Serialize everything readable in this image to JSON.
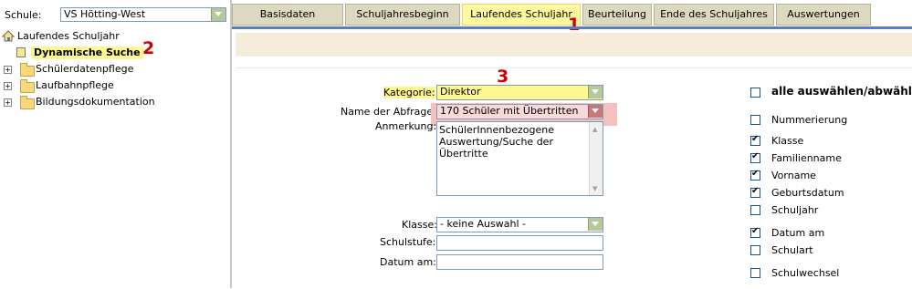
{
  "sidebar": {
    "school_label": "Schule:",
    "school_value": "VS Hötting-West",
    "tree": [
      {
        "label": "Laufendes Schuljahr"
      },
      {
        "label": "Dynamische Suche"
      },
      {
        "label": "Schülerdatenpflege"
      },
      {
        "label": "Laufbahnpflege"
      },
      {
        "label": "Bildungsdokumentation"
      }
    ]
  },
  "tabs": [
    {
      "label": "Basisdaten"
    },
    {
      "label": "Schuljahresbeginn"
    },
    {
      "label": "Laufendes Schuljahr"
    },
    {
      "label": "Beurteilung"
    },
    {
      "label": "Ende des Schuljahres"
    },
    {
      "label": "Auswertungen"
    }
  ],
  "markers": {
    "one": "1",
    "two": "2",
    "three": "3"
  },
  "form": {
    "kategorie_label": "Kategorie:",
    "kategorie_value": "Direktor",
    "abfrage_label": "Name der Abfrage:",
    "abfrage_value": "170 Schüler mit Übertritten",
    "anmerkung_label": "Anmerkung:",
    "anmerkung_value": "SchülerInnenbezogene Auswertung/Suche der Übertritte",
    "klasse_label": "Klasse:",
    "klasse_value": "- keine Auswahl -",
    "schulstufe_label": "Schulstufe:",
    "schulstufe_value": "",
    "datum_label": "Datum am:",
    "datum_value": ""
  },
  "columns": {
    "select_all": "alle auswählen/abwählen",
    "items": [
      {
        "label": "Nummerierung",
        "checked": false
      },
      {
        "label": "Klasse",
        "checked": true
      },
      {
        "label": "Familienname",
        "checked": true
      },
      {
        "label": "Vorname",
        "checked": true
      },
      {
        "label": "Geburtsdatum",
        "checked": true
      },
      {
        "label": "Schuljahr",
        "checked": false
      },
      {
        "label": "Datum am",
        "checked": true
      },
      {
        "label": "Schulart",
        "checked": false
      },
      {
        "label": "Schulwechsel",
        "checked": false
      }
    ]
  },
  "colors": {
    "accent_blue": "#5a7ec0",
    "active_tab": "#fff8a0",
    "highlight_red": "#f4c0c0",
    "marker_red": "#d00000"
  }
}
